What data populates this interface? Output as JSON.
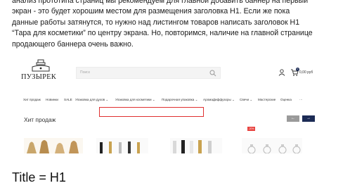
{
  "intro": {
    "lines": [
      "анализ прототипа страниц мы рекомендуем для главной добавить баннер на первый",
      "экран - это будет хорошим местом для размещения заголовка H1. Если же пока",
      "данные работы затянутся, то нужно над листингом товаров написать заголовок H1",
      "“Тара для косметики” по центру экрана. Но, повторимся, наличие на главной странице",
      "продающего баннера очень важно."
    ]
  },
  "header": {
    "logo_text": "ПУЗЫРЕК",
    "search_placeholder": "Поиск",
    "cart_count": "0",
    "cart_total": "0,00 руб"
  },
  "nav": {
    "items": [
      "Хит продаж",
      "Новинки",
      "SALE",
      "Упаковка для духов ⌄",
      "Упаковка для косметики ⌄",
      "Подарочная упаковка ⌄",
      "АромаДиффузоры ⌄",
      "Свечи ⌄",
      "Мастерские",
      "Оценка",
      "···"
    ]
  },
  "section": {
    "title": "Хит продаж",
    "prev_label": "←",
    "next_label": "→",
    "sale_badge": "-20%"
  },
  "caption": {
    "text": "Title = H1"
  },
  "colors": {
    "accent": "#1c2b55",
    "highlight": "#e03030",
    "sale": "#e8433f"
  }
}
